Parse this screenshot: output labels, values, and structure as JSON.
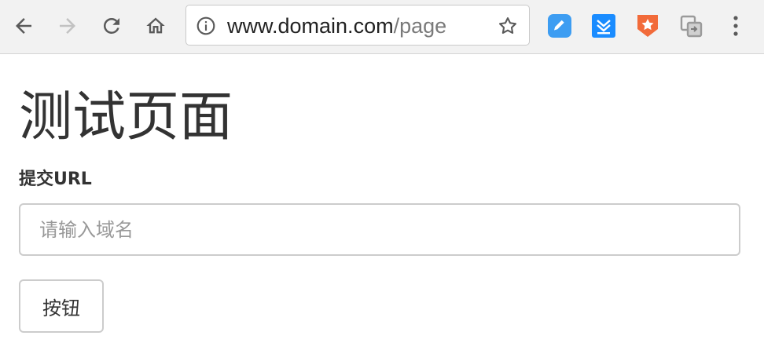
{
  "browser": {
    "url_host": "www.domain.com",
    "url_path": "/page",
    "icons": {
      "back": "back-arrow-icon",
      "forward": "forward-arrow-icon",
      "reload": "reload-icon",
      "home": "home-icon",
      "site_info": "info-icon",
      "bookmark": "star-icon",
      "menu": "more-vert-icon"
    },
    "extensions": [
      {
        "name": "blue-pencil-extension-icon",
        "color": "#3d9df2"
      },
      {
        "name": "blue-download-extension-icon",
        "color": "#1a8cff"
      },
      {
        "name": "orange-star-extension-icon",
        "color": "#f26b3a"
      },
      {
        "name": "gray-share-extension-icon",
        "color": "#9a9a9a"
      }
    ]
  },
  "page": {
    "title": "测试页面",
    "label": "提交URL",
    "input_placeholder": "请输入域名",
    "button_label": "按钮"
  },
  "colors": {
    "text": "#333333",
    "border": "#cccccc",
    "toolbar": "#f2f2f2"
  }
}
